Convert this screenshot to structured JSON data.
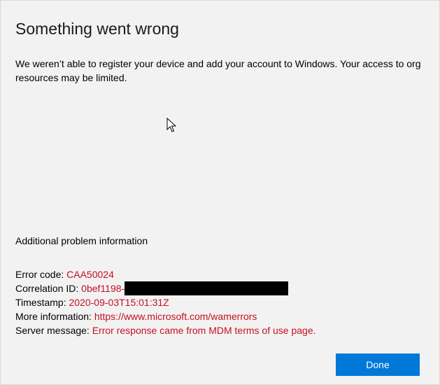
{
  "dialog": {
    "title": "Something went wrong",
    "message": "We weren’t able to register your device and add your account to Windows. Your access to org resources may be limited."
  },
  "additional_info": {
    "heading": "Additional problem information",
    "error_code": {
      "label": "Error code: ",
      "value": "CAA50024"
    },
    "correlation_id": {
      "label": "Correlation ID: ",
      "value": "0bef1198-"
    },
    "timestamp": {
      "label": "Timestamp: ",
      "value": "2020-09-03T15:01:31Z"
    },
    "more_information": {
      "label": "More information: ",
      "value": "https://www.microsoft.com/wamerrors"
    },
    "server_message": {
      "label": "Server message: ",
      "value": "Error response came from MDM terms of use page."
    }
  },
  "buttons": {
    "done_label": "Done"
  },
  "colors": {
    "background": "#f2f2f2",
    "error_text": "#c50f1f",
    "accent": "#0078d7"
  }
}
